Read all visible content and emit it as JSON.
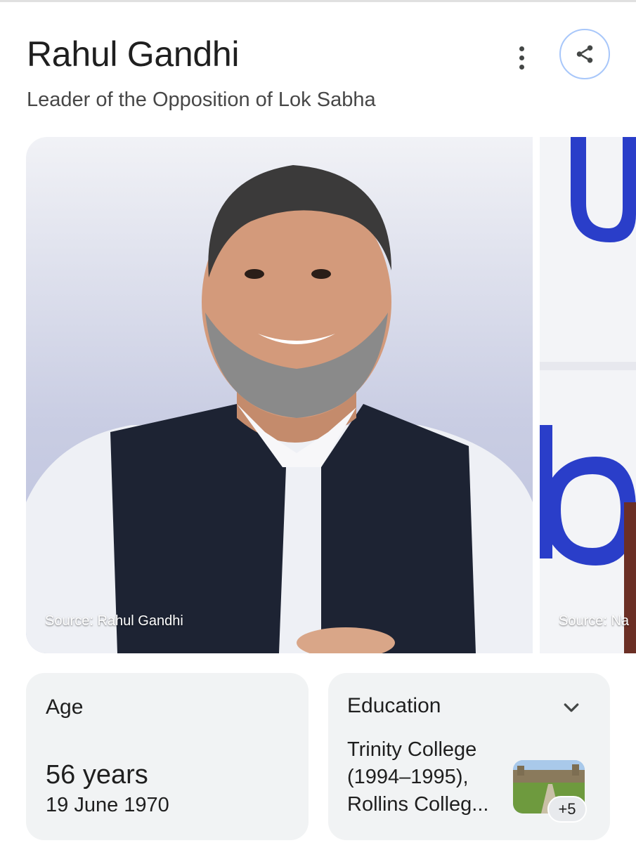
{
  "header": {
    "title": "Rahul Gandhi",
    "subtitle": "Leader of the Opposition of Lok Sabha"
  },
  "icons": {
    "more": "more-vert-icon",
    "share": "share-icon",
    "expand": "chevron-down-icon"
  },
  "colors": {
    "share_ring": "#a8c7fa",
    "card_bg": "#f1f3f4"
  },
  "images": [
    {
      "source": "Source: Rahul Gandhi"
    },
    {
      "source": "Source: Na"
    }
  ],
  "age_card": {
    "label": "Age",
    "value": "56 years",
    "birth_date": "19 June 1970"
  },
  "education_card": {
    "label": "Education",
    "lines": [
      "Trinity College",
      "(1994–1995),",
      "Rollins Colleg..."
    ],
    "more_count": "+5"
  }
}
